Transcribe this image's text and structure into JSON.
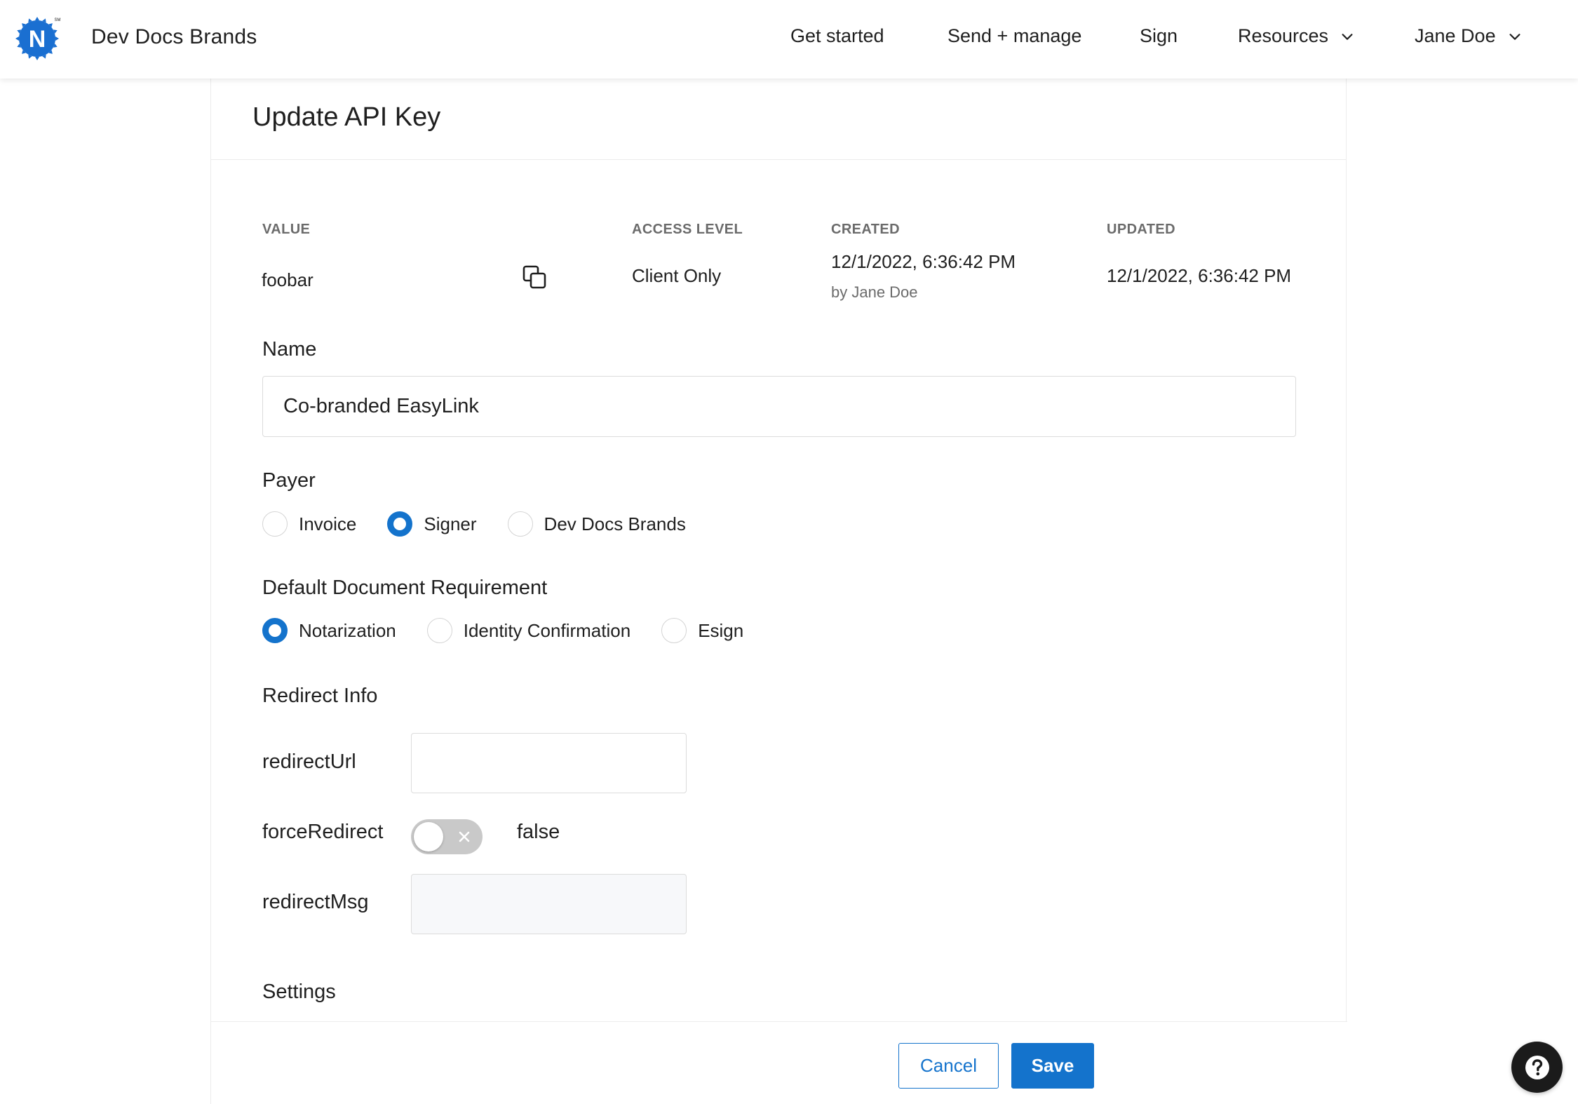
{
  "app": {
    "brand_name": "Dev Docs Brands",
    "logo_letter": "N",
    "logo_mark": "SM"
  },
  "nav": {
    "get_started": "Get started",
    "send_manage": "Send + manage",
    "sign": "Sign",
    "resources": "Resources",
    "user": "Jane Doe"
  },
  "page": {
    "title": "Update API Key"
  },
  "key_info": {
    "value_label": "VALUE",
    "value": "foobar",
    "access_label": "ACCESS LEVEL",
    "access": "Client Only",
    "created_label": "CREATED",
    "created": "12/1/2022, 6:36:42 PM",
    "created_by": "by Jane Doe",
    "updated_label": "UPDATED",
    "updated": "12/1/2022, 6:36:42 PM"
  },
  "form": {
    "name_label": "Name",
    "name_value": "Co-branded EasyLink",
    "payer_label": "Payer",
    "payer_options": [
      "Invoice",
      "Signer",
      "Dev Docs Brands"
    ],
    "payer_selected": "Signer",
    "doc_req_label": "Default Document Requirement",
    "doc_req_options": [
      "Notarization",
      "Identity Confirmation",
      "Esign"
    ],
    "doc_req_selected": "Notarization",
    "redirect_label": "Redirect Info",
    "redirect_url_label": "redirectUrl",
    "redirect_url_value": "",
    "force_redirect_label": "forceRedirect",
    "force_redirect_value": "false",
    "redirect_msg_label": "redirectMsg",
    "redirect_msg_value": "",
    "settings_label": "Settings"
  },
  "actions": {
    "cancel": "Cancel",
    "save": "Save"
  },
  "colors": {
    "accent": "#1473cc",
    "logo_blue": "#1a6fd1",
    "help_bg": "#1b1b1b"
  },
  "icons": {
    "copy": "copy-icon",
    "chevron": "chevron-down-icon",
    "help": "help-icon",
    "toggle_off": "close-icon"
  }
}
